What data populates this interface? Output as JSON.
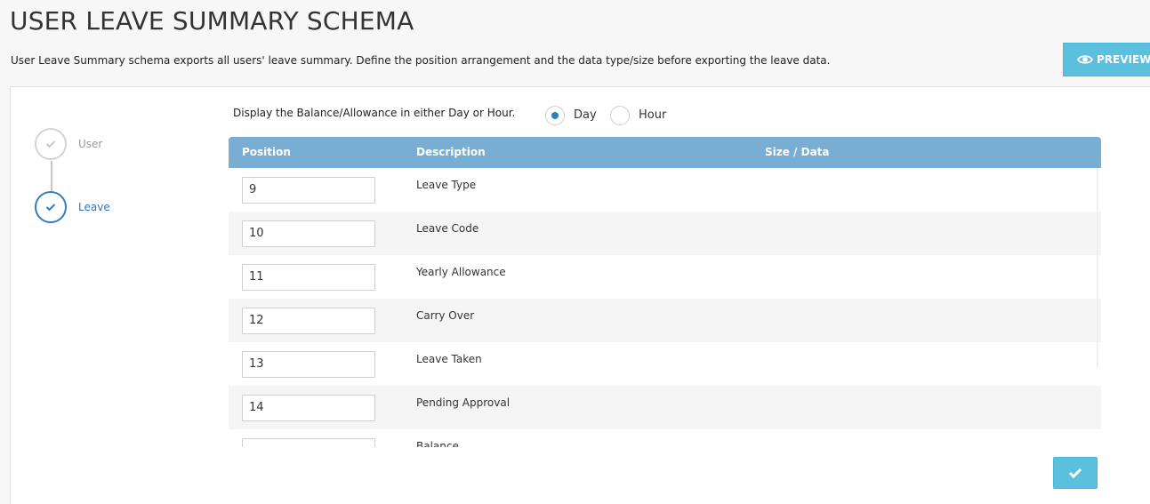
{
  "header": {
    "title": "USER LEAVE SUMMARY SCHEMA",
    "description": "User Leave Summary schema exports all users' leave summary. Define the position arrangement and the data type/size before exporting the leave data.",
    "preview_label": "PREVIEW",
    "accent_color": "#5bc0de"
  },
  "stepper": {
    "steps": [
      {
        "label": "User",
        "state": "completed",
        "icon": "check-icon"
      },
      {
        "label": "Leave",
        "state": "active",
        "icon": "check-icon"
      }
    ],
    "active_color": "#2e7fbf"
  },
  "unit_selector": {
    "label": "Display the Balance/Allowance in either Day or Hour.",
    "options": [
      "Day",
      "Hour"
    ],
    "selected": "Day"
  },
  "table": {
    "header_color": "#78aed4",
    "columns": [
      "Position",
      "Description",
      "Size / Data"
    ],
    "rows": [
      {
        "position": "9",
        "description": "Leave Type"
      },
      {
        "position": "10",
        "description": "Leave Code"
      },
      {
        "position": "11",
        "description": "Yearly Allowance"
      },
      {
        "position": "12",
        "description": "Carry Over"
      },
      {
        "position": "13",
        "description": "Leave Taken"
      },
      {
        "position": "14",
        "description": "Pending Approval"
      },
      {
        "position": "",
        "description": "Balance"
      }
    ]
  },
  "footer": {
    "submit_icon": "check-icon"
  }
}
